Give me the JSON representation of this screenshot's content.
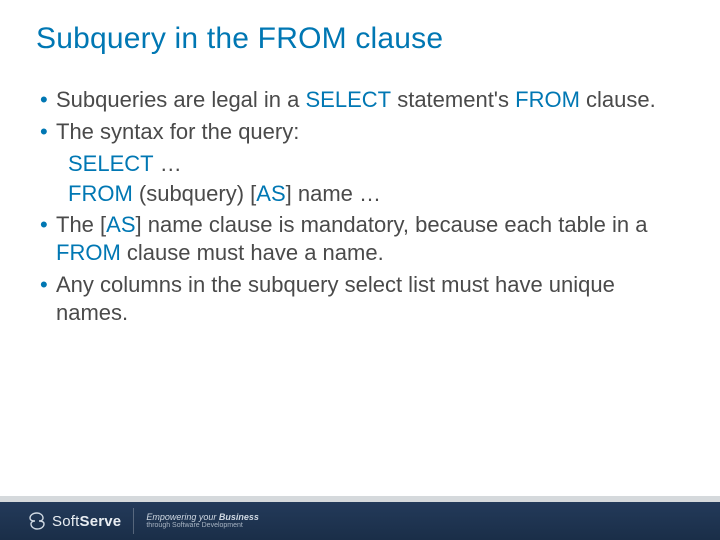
{
  "title": "Subquery in the FROM clause",
  "bullets": {
    "b1": {
      "pre": "Subqueries are legal in a ",
      "kw1": "SELECT",
      "mid": " statement's ",
      "kw2": "FROM",
      "post": " clause."
    },
    "b2": {
      "text": "The syntax for the query:"
    },
    "s1": {
      "kw": "SELECT",
      "rest": " …"
    },
    "s2": {
      "kw": "FROM",
      "mid": " (subquery) [",
      "kw2": "AS",
      "post": "] name …"
    },
    "b3": {
      "pre": "The [",
      "kw1": "AS",
      "mid": "] name clause is mandatory, because each table in a ",
      "kw2": "FROM",
      "post": " clause must have a name."
    },
    "b4": {
      "text": "Any columns in the subquery select list must have unique names."
    }
  },
  "footer": {
    "brand_left": "Soft",
    "brand_right": "Serve",
    "tag_emp": "Empowering your ",
    "tag_bus": "Business",
    "tag_sub": "through Software Development"
  }
}
